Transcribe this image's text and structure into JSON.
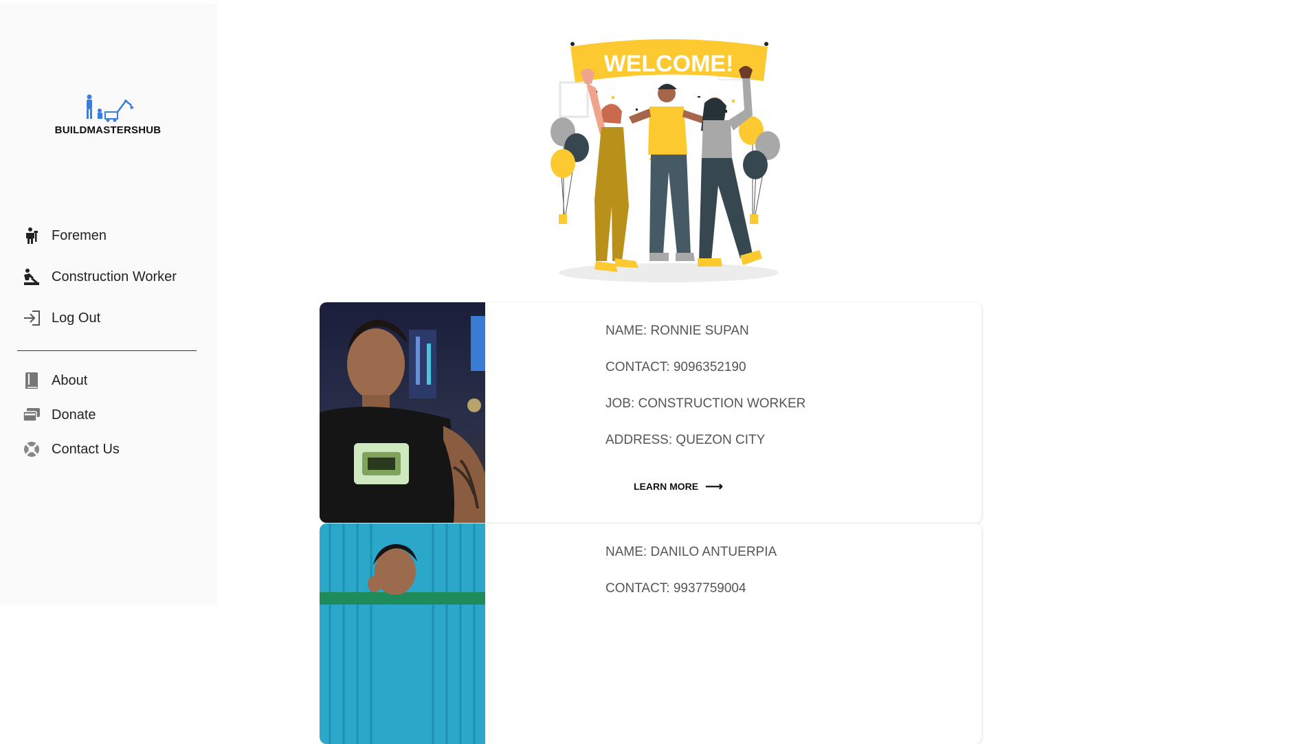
{
  "brand": {
    "name": "BUILDMASTERSHUB",
    "accent": "#3b7ddd"
  },
  "sidebar": {
    "primary": [
      {
        "label": "Foremen",
        "icon": "foreman-icon"
      },
      {
        "label": "Construction Worker",
        "icon": "construction-worker-icon"
      },
      {
        "label": "Log Out",
        "icon": "logout-icon"
      }
    ],
    "secondary": [
      {
        "label": "About",
        "icon": "book-icon"
      },
      {
        "label": "Donate",
        "icon": "card-stack-icon"
      },
      {
        "label": "Contact Us",
        "icon": "support-icon"
      }
    ]
  },
  "hero": {
    "banner_text": "WELCOME!",
    "accent": "#fdc930"
  },
  "workers": [
    {
      "name": "NAME: RONNIE SUPAN",
      "contact": "CONTACT: 9096352190",
      "job": "JOB: CONSTRUCTION WORKER",
      "address": "ADDRESS: QUEZON CITY",
      "action": "LEARN MORE"
    },
    {
      "name": "NAME: DANILO ANTUERPIA",
      "contact": "CONTACT: 9937759004"
    }
  ]
}
